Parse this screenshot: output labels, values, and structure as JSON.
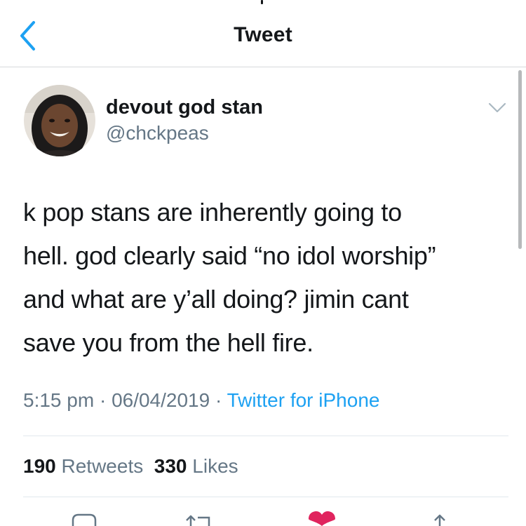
{
  "navbar": {
    "title": "Tweet",
    "back_icon": "chevron-left-icon"
  },
  "tweet": {
    "author": {
      "display_name": "devout god stan",
      "handle": "@chckpeas"
    },
    "text_lines": [
      "k pop stans are inherently going to",
      "hell. god clearly said “no idol worship”",
      "and what are y’all doing? jimin cant",
      "save you from the hell fire."
    ],
    "time": "5:15 pm",
    "date": "06/04/2019",
    "separator": "·",
    "source": "Twitter for iPhone",
    "stats": {
      "retweets_count": "190",
      "retweets_label": "Retweets",
      "likes_count": "330",
      "likes_label": "Likes"
    }
  },
  "actions": [
    "reply-icon",
    "retweet-icon",
    "heart-icon",
    "share-icon"
  ],
  "colors": {
    "accent": "#1da1f2",
    "secondary_text": "#657786",
    "like_red": "#e0245e",
    "divider": "#e1e8ed"
  }
}
